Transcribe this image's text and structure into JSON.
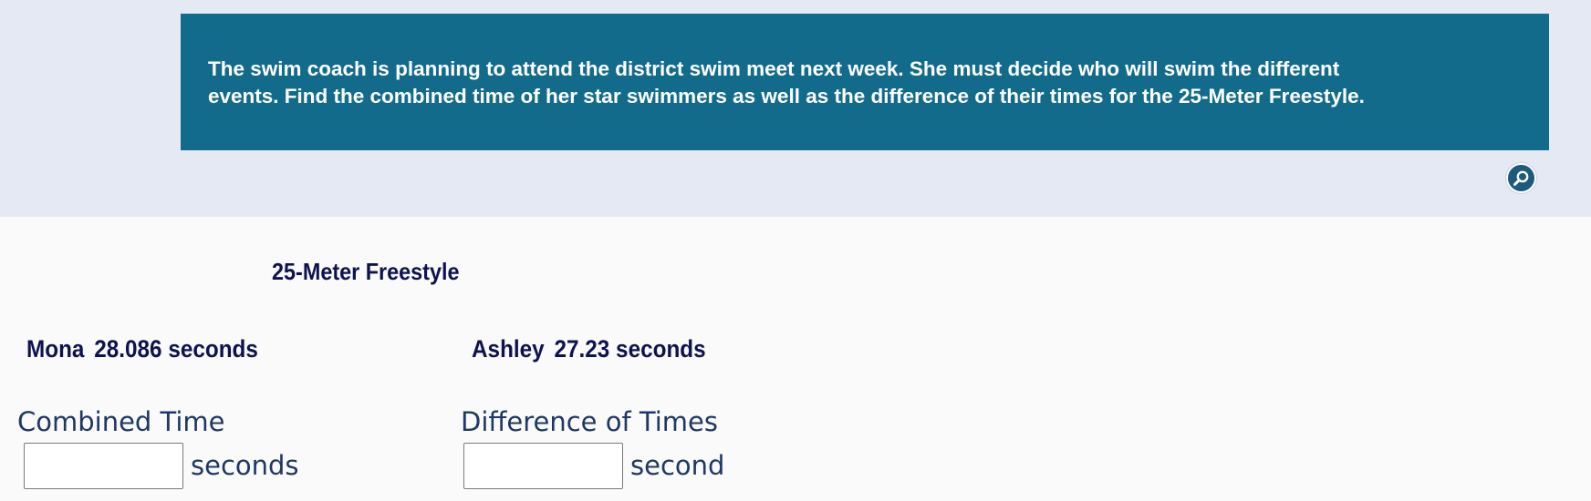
{
  "prompt": {
    "line1": "The swim coach is planning to attend the district swim meet next week. She must decide who will swim the different",
    "line2": "events. Find the combined time of her star swimmers as well as the difference of their times for the 25-Meter Freestyle."
  },
  "zoom": {
    "icon": "magnifier-icon"
  },
  "event": {
    "title": "25-Meter Freestyle"
  },
  "swimmers": [
    {
      "name": "Mona",
      "time": "28.086 seconds"
    },
    {
      "name": "Ashley",
      "time": "27.23 seconds"
    }
  ],
  "answers": {
    "combined": {
      "label": "Combined Time",
      "value": "",
      "unit": "seconds"
    },
    "difference": {
      "label": "Difference of Times",
      "value": "",
      "unit": "second"
    }
  },
  "colors": {
    "prompt_background": "#136b8c",
    "top_background": "#e4e9f3",
    "heading_text": "#0e1350",
    "label_text": "#1f3864"
  }
}
